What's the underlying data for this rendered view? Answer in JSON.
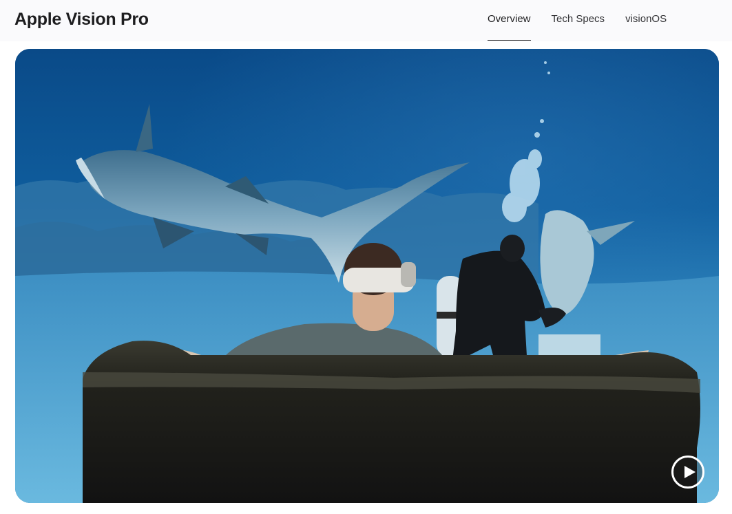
{
  "localnav": {
    "title": "Apple Vision Pro",
    "links": [
      {
        "label": "Overview",
        "active": true
      },
      {
        "label": "Tech Specs",
        "active": false
      },
      {
        "label": "visionOS",
        "active": false
      }
    ]
  },
  "hero": {
    "play_icon": "play-icon"
  },
  "colors": {
    "nav_background": "#fafafc",
    "title_text": "#1d1d1f",
    "water_deep": "#0a4f8e",
    "water_light": "#3a93c6"
  }
}
